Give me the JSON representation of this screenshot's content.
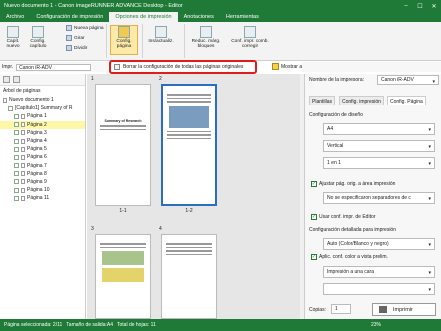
{
  "window": {
    "title": "Nuevo documento 1 - Canon imageRUNNER ADVANCE Desktop - Editor",
    "minimize": "–",
    "maximize": "☐",
    "close": "✕"
  },
  "ribbon_tabs": [
    "Archivo",
    "Configuración de impresión",
    "Opciones de impresión",
    "Anotaciones",
    "Herramientas"
  ],
  "ribbon": {
    "capitulo_nuevo": "Capít. nuevo",
    "config_capitulo": "Config. capítulo",
    "nueva_pagina": "Nueva página",
    "girar": "Girar",
    "dividir": "Dividir",
    "config_pagina": "Config. página",
    "ins_actualiz": "Ins/actualiz.",
    "reduc_marg": "Reduc. márg. bloques",
    "conf_impr_comb": "Conf. impr. comb. corregir"
  },
  "printer_bar": {
    "label": "Impr.",
    "printer": "Canon iR-ADV"
  },
  "reset_button": "Borrar la configuración de todas las páginas originales",
  "show_annotations": "Mostrar anotac.",
  "tree": {
    "title": "Árbol de páginas",
    "root": "Nuevo documento 1",
    "chapter": "[Capítulo1] Summary of R",
    "pages": [
      "Página 1",
      "Página 2",
      "Página 3",
      "Página 4",
      "Página 5",
      "Página 6",
      "Página 7",
      "Página 8",
      "Página 9",
      "Página 10",
      "Página 11"
    ]
  },
  "thumbnails": {
    "labels": [
      "1-1",
      "1-2"
    ],
    "page_numbers": [
      "1",
      "2",
      "3",
      "4"
    ],
    "doc_title": "Summary of Research"
  },
  "right_panel": {
    "printer_name_label": "Nombre de la impresora:",
    "printer_name": "Canon iR-ADV",
    "tabs": [
      "Plantillas",
      "Config. impresión",
      "Config. Página"
    ],
    "layout_label": "Configuración de diseño",
    "layout_dd1": "A4",
    "layout_dd2": "Vertical",
    "layout_dd3": "1 en 1",
    "chk_adjust": "Ajustar pág. orig. a área impresión",
    "no_separator": "No se especificaron separadores de c",
    "chk_user_conf": "Usar conf. impr. de Editor",
    "detail_label": "Configuración detallada para impresión",
    "color_dd": "Auto (Color/Blanco y negro)",
    "chk_color": "Aplic. conf. color a vista prelim.",
    "print_side": "Impresión a una cara",
    "copies_label": "Copias:",
    "copies_value": "1",
    "print_button": "Imprimir"
  },
  "status": {
    "selected_page": "Página seleccionada: 2/11",
    "output_size": "Tamaño de salida:A4",
    "total_sheets": "Total de hojas: 11",
    "zoom": "23%"
  },
  "colors": {
    "brand_green": "#1e7a36",
    "reset_red": "#e21b1b",
    "selected_yellow": "#fff7a8"
  }
}
